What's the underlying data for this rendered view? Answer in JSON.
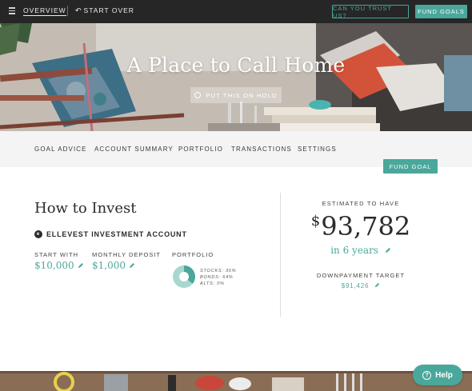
{
  "topnav": {
    "overview": "OVERVIEW",
    "start_over": "START OVER",
    "trust_button": "CAN YOU TRUST US?",
    "fund_goals_button": "FUND GOALS"
  },
  "hero": {
    "title": "A Place to Call Home",
    "hold_button": "PUT THIS ON HOLD"
  },
  "subnav": {
    "items": [
      "GOAL ADVICE",
      "ACCOUNT SUMMARY",
      "PORTFOLIO",
      "TRANSACTIONS",
      "SETTINGS"
    ],
    "fund_goal_button": "FUND GOAL"
  },
  "invest": {
    "heading": "How to Invest",
    "account_name": "ELLEVEST INVESTMENT ACCOUNT",
    "start_with_label": "START WITH",
    "start_with_value": "$10,000",
    "monthly_label": "MONTHLY DEPOSIT",
    "monthly_value": "$1,000",
    "portfolio_label": "PORTFOLIO",
    "allocation": {
      "stocks": "STOCKS: 36%",
      "bonds": "BONDS: 64%",
      "alts": "ALTS: 0%"
    },
    "portfolio_values": {
      "stocks": 36,
      "bonds": 64,
      "alts": 0
    }
  },
  "estimate": {
    "label": "ESTIMATED TO HAVE",
    "currency": "$",
    "amount": "93,782",
    "years": "in 6 years",
    "downpayment_label": "DOWNPAYMENT TARGET",
    "downpayment_value": "$91,426"
  },
  "help": {
    "label": "Help"
  },
  "colors": {
    "accent": "#4aa79b",
    "nav_bg": "#262626",
    "subnav_bg": "#f4f4f4",
    "stocks": "#4aa79b",
    "bonds": "#a9d6d0"
  }
}
